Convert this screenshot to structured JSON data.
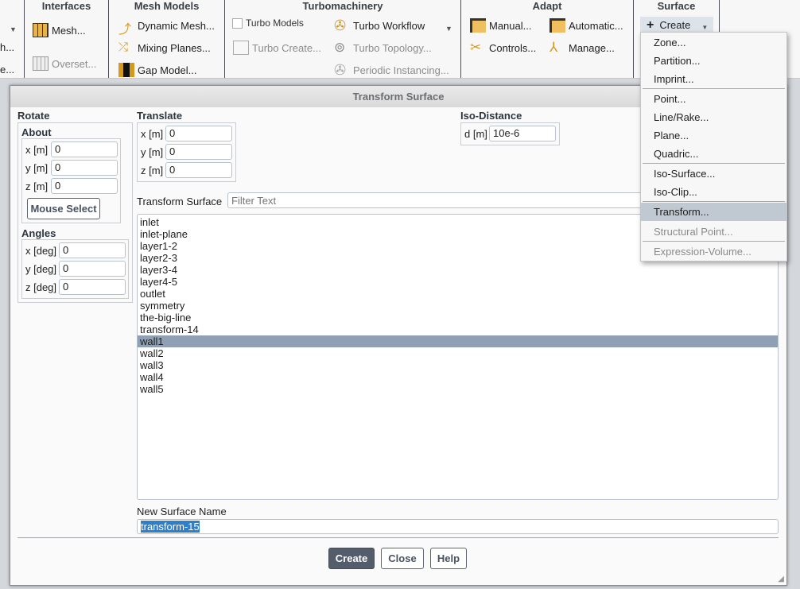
{
  "ribbon": {
    "partial": {
      "item1": "h...",
      "item2": "e..."
    },
    "interfaces": {
      "title": "Interfaces",
      "mesh": "Mesh...",
      "overset": "Overset..."
    },
    "mesh_models": {
      "title": "Mesh Models",
      "dynamic": "Dynamic Mesh...",
      "mixing": "Mixing Planes...",
      "gap": "Gap Model..."
    },
    "turbo": {
      "title": "Turbomachinery",
      "models": "Turbo Models",
      "workflow": "Turbo Workflow",
      "create": "Turbo Create...",
      "topology": "Turbo Topology...",
      "periodic": "Periodic Instancing..."
    },
    "adapt": {
      "title": "Adapt",
      "manual": "Manual...",
      "automatic": "Automatic...",
      "controls": "Controls...",
      "manage": "Manage..."
    },
    "surface": {
      "title": "Surface",
      "create": "Create"
    }
  },
  "menu": {
    "items": [
      "Zone...",
      "Partition...",
      "Imprint...",
      "Point...",
      "Line/Rake...",
      "Plane...",
      "Quadric...",
      "Iso-Surface...",
      "Iso-Clip...",
      "Transform...",
      "Structural Point...",
      "Expression-Volume..."
    ]
  },
  "dialog": {
    "title": "Transform Surface",
    "rotate": {
      "label": "Rotate",
      "about": "About",
      "x_label": "x [m]",
      "x": "0",
      "y_label": "y [m]",
      "y": "0",
      "z_label": "z [m]",
      "z": "0",
      "mouse_select": "Mouse Select",
      "angles": "Angles",
      "ax_label": "x [deg]",
      "ax": "0",
      "ay_label": "y [deg]",
      "ay": "0",
      "az_label": "z [deg]",
      "az": "0"
    },
    "translate": {
      "label": "Translate",
      "x_label": "x [m]",
      "x": "0",
      "y_label": "y [m]",
      "y": "0",
      "z_label": "z [m]",
      "z": "0"
    },
    "iso": {
      "label": "Iso-Distance",
      "d_label": "d [m]",
      "d": "10e-6"
    },
    "surface_label": "Transform Surface",
    "filter_placeholder": "Filter Text",
    "surfaces": [
      "inlet",
      "inlet-plane",
      "layer1-2",
      "layer2-3",
      "layer3-4",
      "layer4-5",
      "outlet",
      "symmetry",
      "the-big-line",
      "transform-14",
      "wall1",
      "wall2",
      "wall3",
      "wall4",
      "wall5"
    ],
    "selected": "wall1",
    "new_name_label": "New Surface Name",
    "new_name": "transform-15",
    "create": "Create",
    "close": "Close",
    "help": "Help"
  }
}
